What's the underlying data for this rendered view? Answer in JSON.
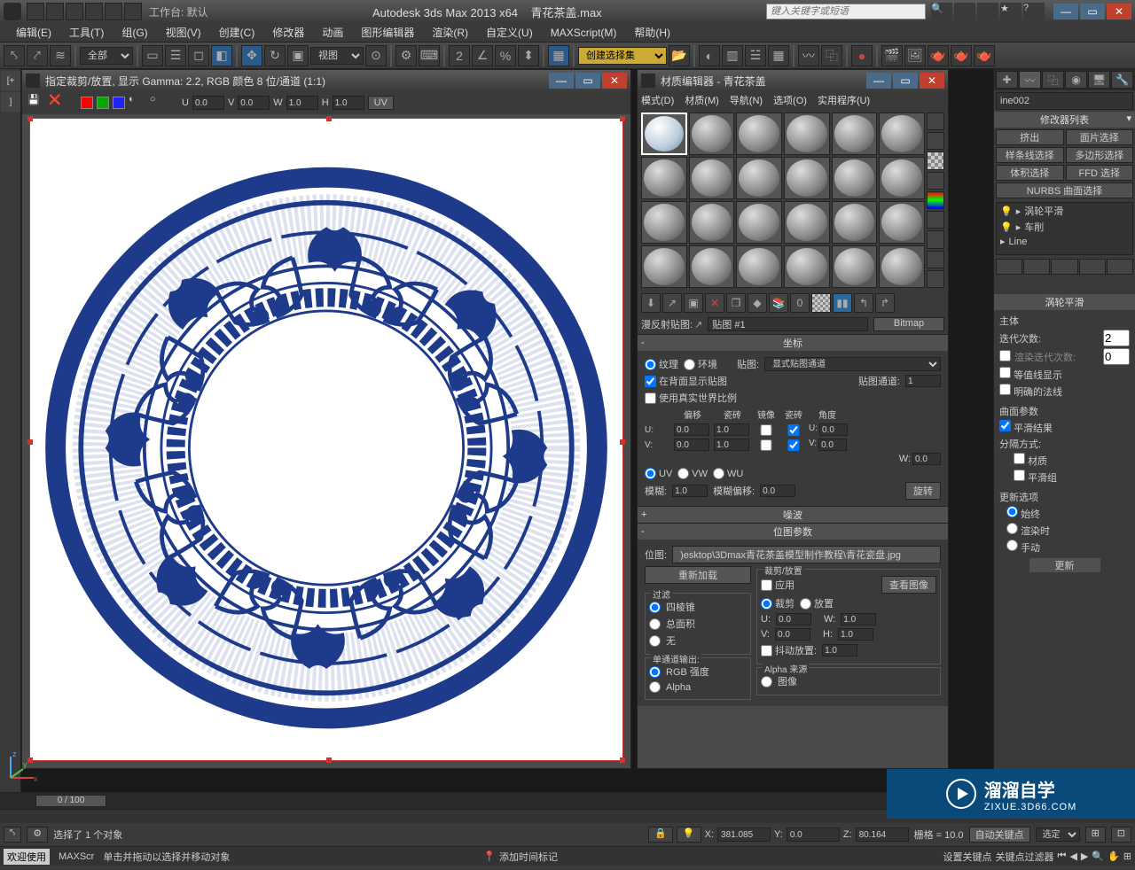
{
  "titlebar": {
    "workspace_label": "工作台: 默认",
    "app_title": "Autodesk 3ds Max  2013 x64",
    "file_name": "青花茶盖.max",
    "search_placeholder": "键入关键字或短语"
  },
  "menubar": {
    "items": [
      "编辑(E)",
      "工具(T)",
      "组(G)",
      "视图(V)",
      "创建(C)",
      "修改器",
      "动画",
      "图形编辑器",
      "渲染(R)",
      "自定义(U)",
      "MAXScript(M)",
      "帮助(H)"
    ]
  },
  "toolbar": {
    "filter_label": "全部",
    "view_dropdown": "视图",
    "create_set_placeholder": "创建选择集"
  },
  "img_window": {
    "title": "指定裁剪/放置, 显示 Gamma: 2.2, RGB 颜色 8 位/通道 (1:1)",
    "uvw": {
      "u_label": "U",
      "u_val": "0.0",
      "v_label": "V",
      "v_val": "0.0",
      "w_label": "W",
      "w_val": "1.0",
      "h_label": "H",
      "h_val": "1.0",
      "uv_btn": "UV"
    }
  },
  "mat_editor": {
    "title": "材质编辑器 - 青花茶盖",
    "menu": [
      "模式(D)",
      "材质(M)",
      "导航(N)",
      "选项(O)",
      "实用程序(U)"
    ],
    "map_row": {
      "label": "漫反射贴图:",
      "name": "贴图 #1",
      "type": "Bitmap"
    },
    "coords": {
      "head": "坐标",
      "radio_tex": "纹理",
      "radio_env": "环境",
      "map_label": "贴图:",
      "map_channel": "显式贴图通道",
      "show_back": "在背面显示贴图",
      "map_channel_label": "贴图通道:",
      "map_channel_val": "1",
      "real_world": "使用真实世界比例",
      "offset_head": "偏移",
      "tiling_head": "瓷砖",
      "mirror_head": "镜像",
      "tile_head": "瓷砖",
      "angle_head": "角度",
      "u_label": "U:",
      "u_off": "0.0",
      "u_tile": "1.0",
      "u_ang": "0.0",
      "v_label": "V:",
      "v_off": "0.0",
      "v_tile": "1.0",
      "v_ang": "0.0",
      "w_label": "W:",
      "w_ang": "0.0",
      "uv": "UV",
      "vw": "VW",
      "wu": "WU",
      "blur_label": "模糊:",
      "blur_val": "1.0",
      "blur_off_label": "模糊偏移:",
      "blur_off_val": "0.0",
      "rotate": "旋转"
    },
    "noise_head": "噪波",
    "bitmap": {
      "head": "位图参数",
      "path_label": "位图:",
      "path": ")esktop\\3Dmax青花茶盖模型制作教程\\青花瓷盘.jpg",
      "reload": "重新加载",
      "crop_place": "裁剪/放置",
      "apply": "应用",
      "view_img": "查看图像",
      "crop": "裁剪",
      "place": "放置",
      "filter": "过滤",
      "pyramidal": "四棱锥",
      "sat": "总面积",
      "none": "无",
      "u_label": "U:",
      "u_val": "0.0",
      "w_label": "W:",
      "w_val": "1.0",
      "v_label": "V:",
      "v_val": "0.0",
      "h_label": "H:",
      "h_val": "1.0",
      "jitter": "抖动放置:",
      "jitter_val": "1.0",
      "mono_out": "单通道输出:",
      "rgb_int": "RGB 强度",
      "alpha": "Alpha",
      "alpha_src": "Alpha 来源",
      "img_alpha": "图像"
    }
  },
  "cmd_panel": {
    "obj_name": "ine002",
    "mod_list_label": "修改器列表",
    "btns": [
      "挤出",
      "面片选择",
      "样条线选择",
      "多边形选择",
      "体积选择",
      "FFD 选择",
      "NURBS 曲面选择"
    ],
    "stack": [
      "涡轮平滑",
      "车削",
      "Line"
    ],
    "turbo_head": "涡轮平滑",
    "main_grp": "主体",
    "iter_label": "迭代次数:",
    "iter_val": "2",
    "render_iter_label": "渲染迭代次数:",
    "render_iter_val": "0",
    "isoline": "等值线显示",
    "explicit_normals": "明确的法线",
    "surf_params": "曲面参数",
    "smooth_result": "平滑结果",
    "sep_by": "分隔方式:",
    "material": "材质",
    "smooth_grp": "平滑组",
    "update_opts": "更新选项",
    "always": "始终",
    "on_render": "渲染时",
    "manual": "手动",
    "update_btn": "更新"
  },
  "timeline": {
    "frame_display": "0 / 100"
  },
  "status": {
    "sel_text": "选择了 1 个对象",
    "x_label": "X:",
    "x_val": "381.085",
    "y_label": "Y:",
    "y_val": "0.0",
    "z_label": "Z:",
    "z_val": "80.164",
    "grid_label": "栅格 = 10.0",
    "auto_key": "自动关键点",
    "sel_set": "选定",
    "set_key": "设置关键点",
    "key_filter": "关键点过滤器"
  },
  "prompt": {
    "welcome": "欢迎使用",
    "maxscript": "MAXScr",
    "hint": "单击并拖动以选择并移动对象",
    "add_time": "添加时间标记"
  },
  "watermark": {
    "brand": "溜溜自学",
    "url": "ZIXUE.3D66.COM"
  }
}
